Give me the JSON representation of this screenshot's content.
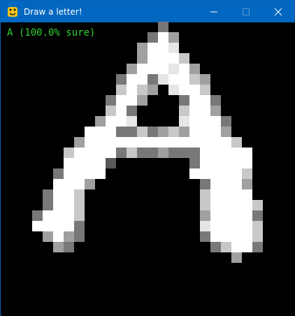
{
  "window": {
    "title": "Draw a letter!",
    "titlebar_color": "#0167c0",
    "app_icon": "python-icon",
    "controls": [
      "minimize-icon",
      "maximize-icon",
      "close-icon"
    ]
  },
  "prediction": {
    "text": "A (100.0% sure)",
    "letter": "A",
    "confidence_percent": 100.0,
    "color": "#2ed32e"
  },
  "canvas": {
    "background": "#000000",
    "grid_size": 28,
    "shade_palette": {
      "W": "#ffffff",
      "L": "#e6e6e6",
      "M": "#c8c8c8",
      "G": "#a0a0a0",
      "D": "#787878",
      "K": "#585858"
    },
    "drawing_rows": [
      "...............D............",
      "..............DWG...........",
      ".............GWWL...........",
      ".............GWWWM..........",
      "............GWWWLWG.........",
      "...........DWWDLWWMG........",
      "...........MWMG.LWWM........",
      "..........DWWG...DWWD.......",
      "..........MWD....MWWG.......",
      ".........GWWL....LWWWD......",
      "........WWWDDMDGMGWWWG......",
      ".......GWWWWWWWWWWWWWWM.....",
      "......MWWWWDMDDGDDDWWWWW....",
      "......WWWWK.......DWWWWW....",
      ".....DWWWW........WWWWWM....",
      ".....WWWG..........DWWWG....",
      "....DWWM...........MWWWW....",
      "....DWWM...........MWWWWM...",
      "...DWWWM...........GWWWWD...",
      "...WWWWD...........LWWWWM...",
      "....GWGD...........DWWWWM...",
      ".....GD.............DMWWD...",
      "......................G.....",
      "............................",
      "............................",
      "............................",
      "............................",
      "............................"
    ]
  }
}
